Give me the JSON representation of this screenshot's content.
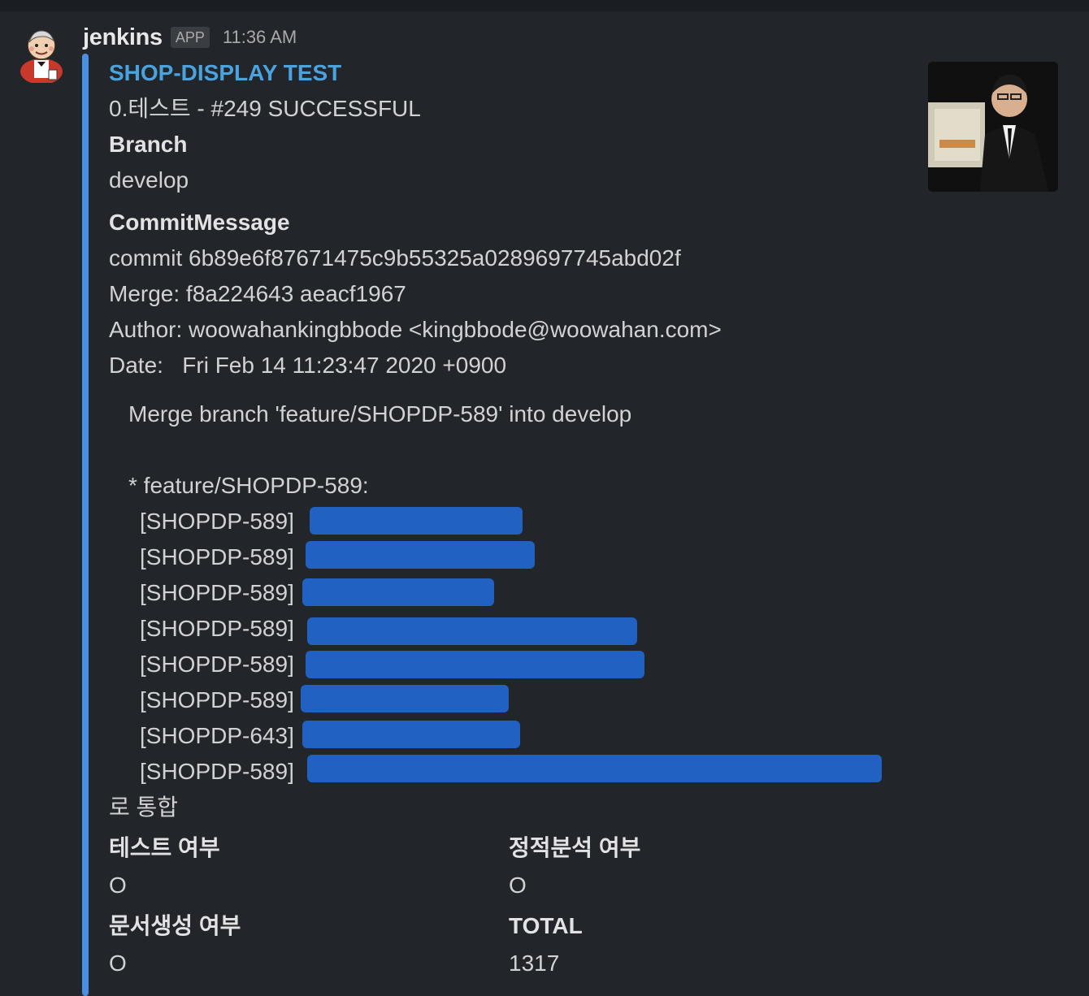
{
  "message": {
    "username": "jenkins",
    "badge": "APP",
    "timestamp": "11:36 AM"
  },
  "attachment": {
    "title": "SHOP-DISPLAY TEST",
    "status_line": "0.테스트 - #249 SUCCESSFUL",
    "branch_label": "Branch",
    "branch_value": "develop",
    "commit_label": "CommitMessage",
    "commit_lines": [
      "commit 6b89e6f87671475c9b55325a0289697745abd02f",
      "Merge: f8a224643 aeacf1967",
      "Author: woowahankingbbode <kingbbode@woowahan.com>",
      "Date:   Fri Feb 14 11:23:47 2020 +0900"
    ],
    "merge_line": "Merge branch 'feature/SHOPDP-589' into develop",
    "feature_line": "* feature/SHOPDP-589:",
    "ticket_lines": [
      "[SHOPDP-589]",
      "[SHOPDP-589]",
      "[SHOPDP-589]",
      "[SHOPDP-589]",
      "[SHOPDP-589]",
      "[SHOPDP-589]",
      "[SHOPDP-643]",
      "[SHOPDP-589]"
    ],
    "closing_line": "로 통합",
    "fields": [
      {
        "label": "테스트 여부",
        "value": "O"
      },
      {
        "label": "정적분석 여부",
        "value": "O"
      },
      {
        "label": "문서생성 여부",
        "value": "O"
      },
      {
        "label": "TOTAL",
        "value": "1317"
      }
    ],
    "colors": {
      "accent_bar": "#4a90e2",
      "title_link": "#4aa3df",
      "redaction": "#2061c2"
    }
  }
}
